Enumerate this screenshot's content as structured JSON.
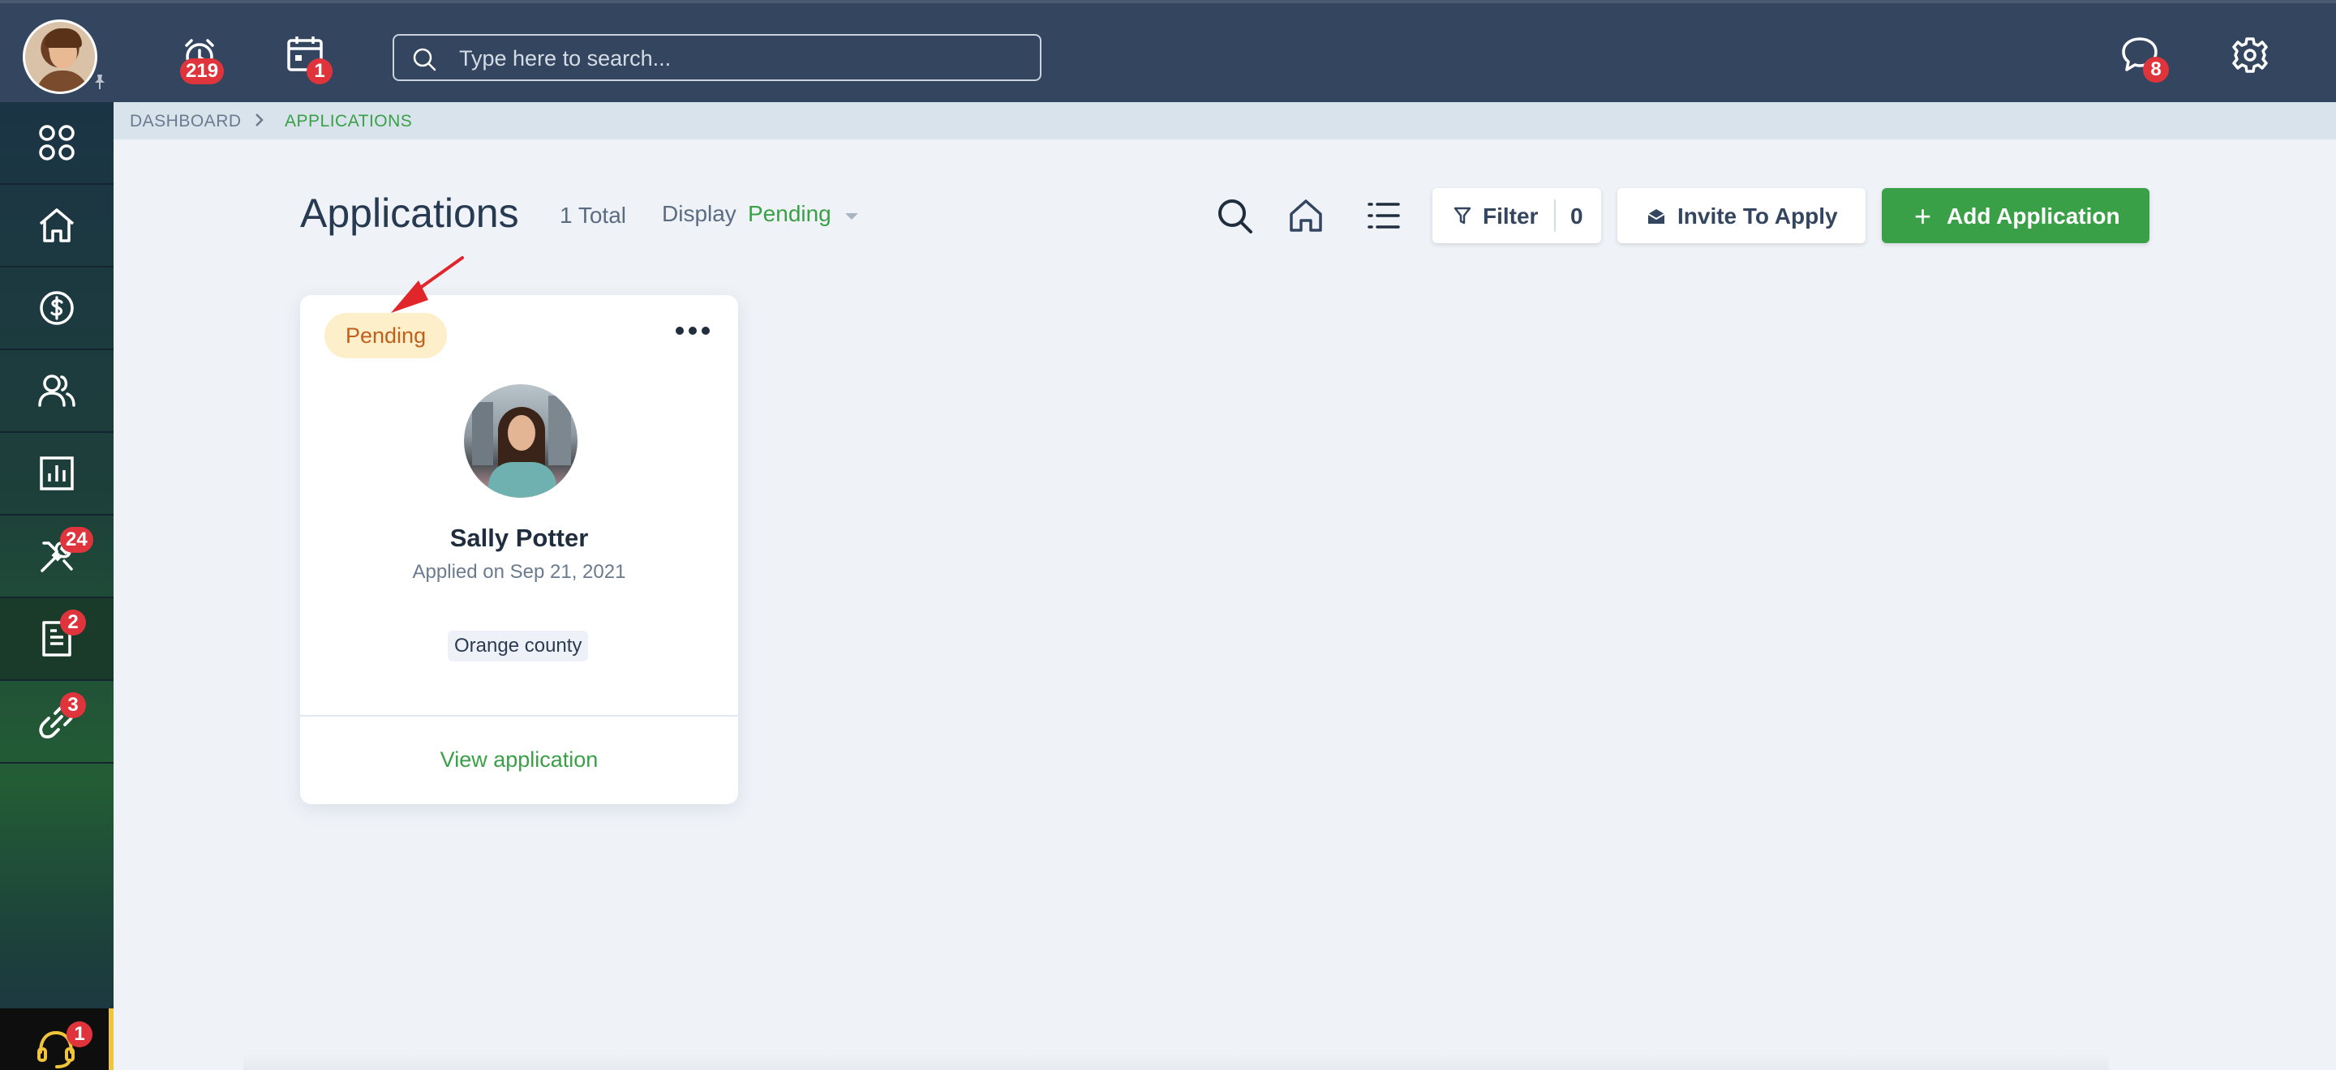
{
  "topbar": {
    "alarm_badge": "219",
    "calendar_badge": "1",
    "search": {
      "placeholder": "Type here to search..."
    },
    "chat_badge": "8"
  },
  "sidebar": {
    "items": [
      {
        "icon": "apps-grid-icon",
        "badge": ""
      },
      {
        "icon": "home-icon",
        "badge": ""
      },
      {
        "icon": "dollar-icon",
        "badge": ""
      },
      {
        "icon": "users-icon",
        "badge": ""
      },
      {
        "icon": "reports-chart-icon",
        "badge": ""
      },
      {
        "icon": "tools-icon",
        "badge": "24"
      },
      {
        "icon": "document-icon",
        "badge": "2"
      },
      {
        "icon": "link-icon",
        "badge": "3"
      }
    ],
    "support_badge": "1"
  },
  "breadcrumb": {
    "home": "DASHBOARD",
    "current": "APPLICATIONS"
  },
  "header": {
    "title": "Applications",
    "total": "1 Total",
    "display_label": "Display",
    "display_value": "Pending"
  },
  "toolbar": {
    "filter_label": "Filter",
    "filter_count": "0",
    "invite_label": "Invite To Apply",
    "add_label": "Add Application",
    "add_plus": "+"
  },
  "applications": [
    {
      "status": "Pending",
      "name": "Sally Potter",
      "applied_on": "Applied on Sep 21, 2021",
      "location": "Orange county",
      "view_label": "View application"
    }
  ],
  "colors": {
    "topbar": "#34465f",
    "accent_green": "#3aa047",
    "badge_red": "#e0343c",
    "pending_bg": "#fdefc9",
    "pending_text": "#c0601c"
  }
}
